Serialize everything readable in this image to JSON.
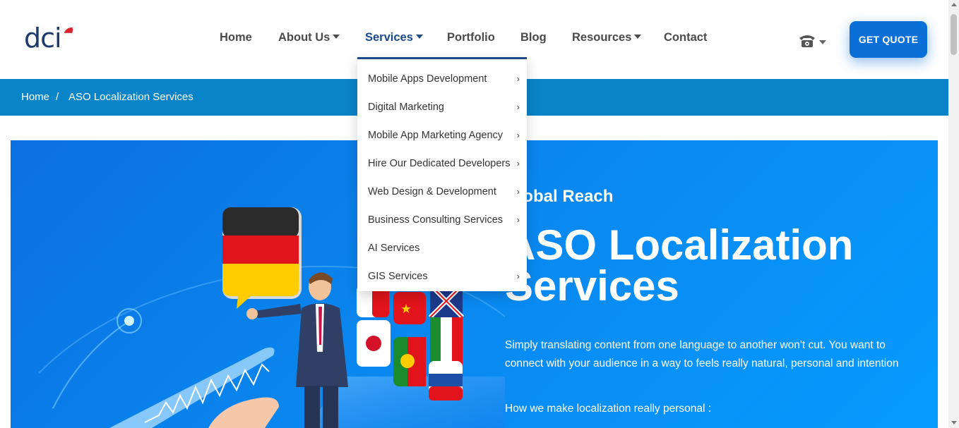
{
  "logo": {
    "text": "dci"
  },
  "nav": {
    "home": "Home",
    "about": "About Us",
    "services": "Services",
    "portfolio": "Portfolio",
    "blog": "Blog",
    "resources": "Resources",
    "contact": "Contact",
    "phone_icon": "telephone-icon",
    "quote_label": "GET QUOTE"
  },
  "breadcrumb": {
    "home": "Home",
    "separator": "/",
    "current": "ASO Localization Services"
  },
  "services_menu": {
    "items": [
      {
        "label": "Mobile Apps Development",
        "has_submenu": true
      },
      {
        "label": "Digital Marketing",
        "has_submenu": true
      },
      {
        "label": "Mobile App Marketing Agency",
        "has_submenu": true
      },
      {
        "label": "Hire Our Dedicated Developers",
        "has_submenu": true
      },
      {
        "label": "Web Design & Development",
        "has_submenu": true
      },
      {
        "label": "Business Consulting Services",
        "has_submenu": true
      },
      {
        "label": "AI Services",
        "has_submenu": false
      },
      {
        "label": "GIS Services",
        "has_submenu": true
      }
    ],
    "arrow": "›"
  },
  "hero": {
    "eyebrow": "Global Reach",
    "title": "ASO Localization Services",
    "description": "Simply translating content from one language to another won't cut. You want to connect with your audience in a way to feels really natural, personal and intention",
    "subheading": "How we make localization really personal :"
  },
  "colors": {
    "brand_blue": "#0a6fd6",
    "breadcrumb_bg": "#0a84c8",
    "nav_active": "#1a4a8a",
    "hero_gradient_start": "#0b6fe0",
    "hero_gradient_end": "#069bff"
  }
}
